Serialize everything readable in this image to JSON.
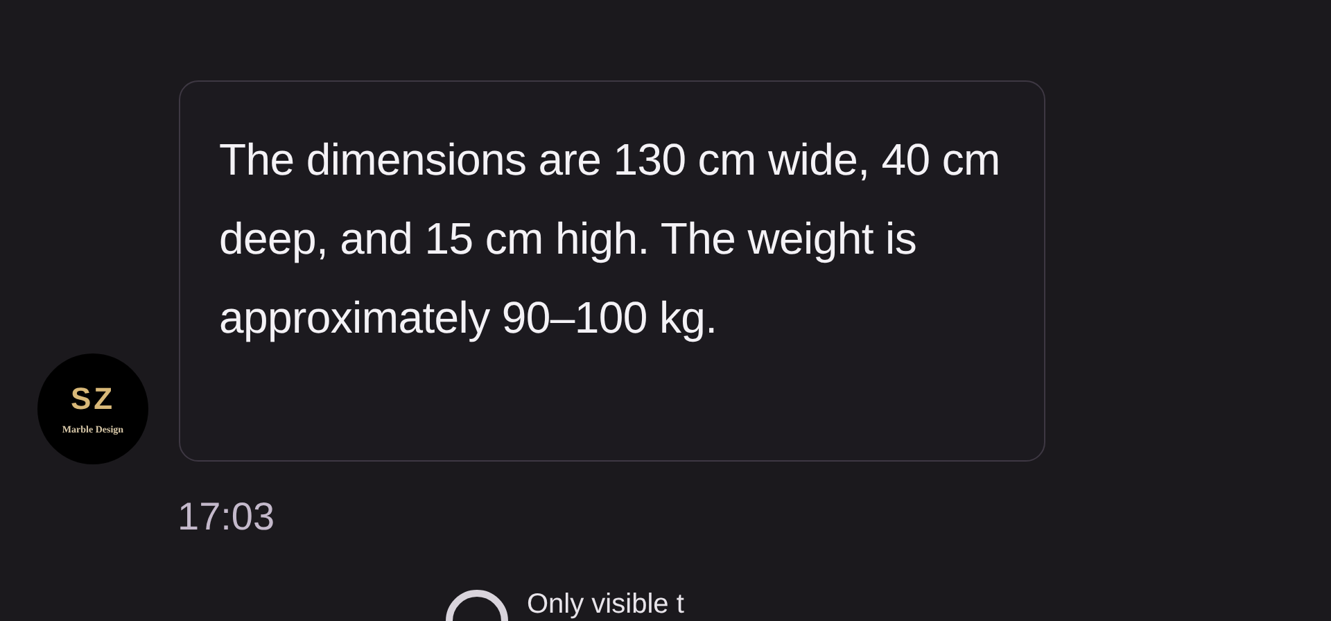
{
  "message": {
    "text": "The dimensions are 130 cm wide, 40 cm deep, and 15 cm high. The weight is approximately 90–100 kg.",
    "time": "17:03"
  },
  "avatar": {
    "initials": "SZ",
    "caption": "Marble Design"
  },
  "footer_note": {
    "text": "Only visible t"
  }
}
